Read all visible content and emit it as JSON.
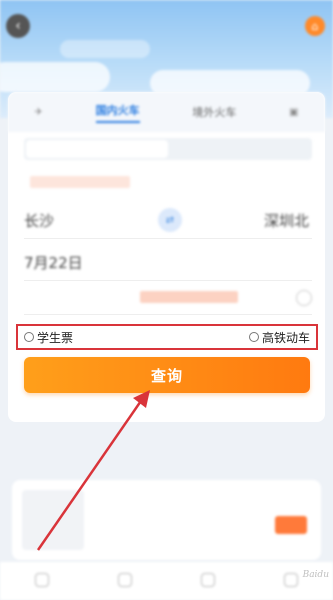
{
  "header": {
    "back_icon": "arrow-left-icon",
    "home_icon": "home-icon"
  },
  "tabs": [
    {
      "label": "",
      "icon": "plane-icon"
    },
    {
      "label": "国内火车",
      "active": true
    },
    {
      "label": "境外火车"
    },
    {
      "label": "",
      "icon": "bus-icon"
    }
  ],
  "trip": {
    "from_city": "长沙",
    "to_city": "深圳北",
    "date": "7月22日",
    "swap_icon": "swap-icon"
  },
  "options": {
    "student_ticket": "学生票",
    "high_speed": "高铁动车"
  },
  "search": {
    "button_label": "查询"
  },
  "colors": {
    "accent_orange": "#ff8a1a",
    "annotation_red": "#d9343a",
    "tab_blue": "#2b7de0"
  },
  "watermark": "Baidu"
}
